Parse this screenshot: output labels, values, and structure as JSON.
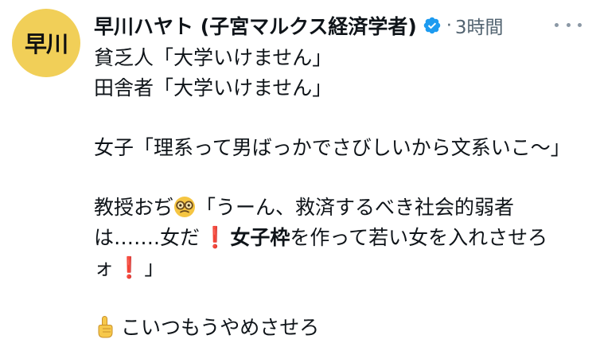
{
  "author": {
    "avatar_text": "早川",
    "display_name": "早川ハヤト (子宮マルクス経済学者)",
    "verified": true,
    "separator": "·",
    "timestamp": "3時間"
  },
  "post": {
    "line1": "貧乏人「大学いけません」",
    "line2": "田舎者「大学いけません」",
    "line3": "女子「理系って男ばっかでさびしいから文系いこ〜」",
    "line4_prefix": "教授おぢ",
    "line4_suffix": "「うーん、救済するべき社会的弱者",
    "line5_prefix": "は…….女だ",
    "line5_bold": "女子枠",
    "line5_suffix": "を作って若い女を入れさせろ",
    "line6_prefix": "ォ",
    "line6_suffix": "」",
    "exclaim_glyph": "❗",
    "line7": "こいつもうやめさせろ"
  },
  "colors": {
    "avatar_bg": "#f1cf58",
    "verified_blue": "#1d9bf0",
    "muted_text": "#536471",
    "exclaim_red": "#e0262d"
  },
  "icons": {
    "verified": "verified-badge-icon",
    "more": "more-options-icon",
    "glasses_face": "nerd-face-emoji-icon",
    "pointing_hand": "backhand-index-pointing-up-emoji-icon",
    "exclamation": "red-exclamation-mark-icon"
  }
}
